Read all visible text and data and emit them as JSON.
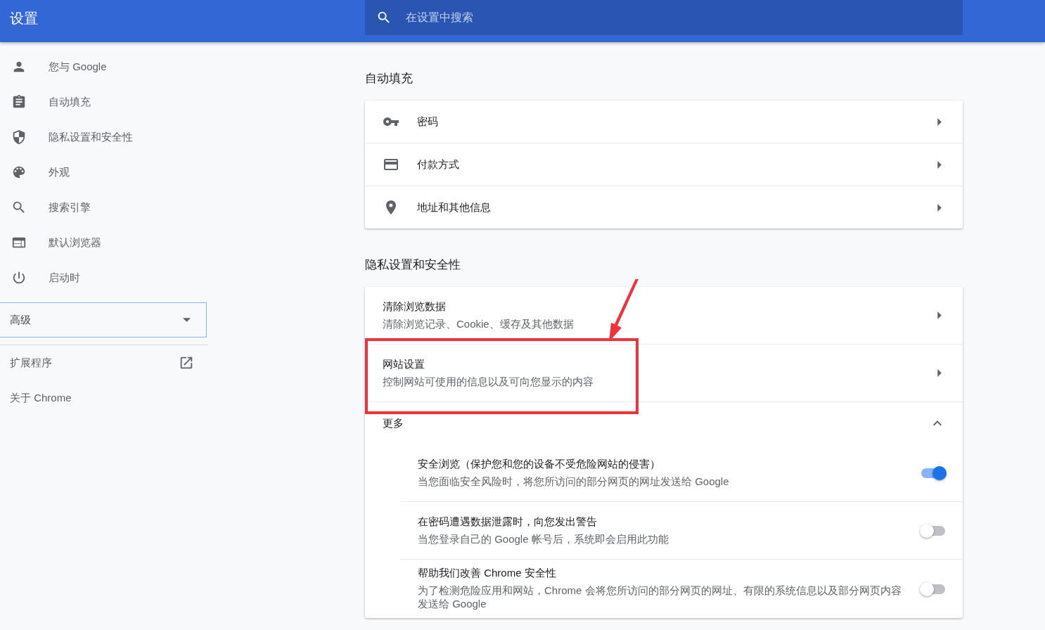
{
  "header": {
    "title": "设置",
    "search": {
      "placeholder": "在设置中搜索"
    }
  },
  "sidebar": {
    "items": [
      {
        "label": "您与 Google"
      },
      {
        "label": "自动填充"
      },
      {
        "label": "隐私设置和安全性"
      },
      {
        "label": "外观"
      },
      {
        "label": "搜索引擎"
      },
      {
        "label": "默认浏览器"
      },
      {
        "label": "启动时"
      }
    ],
    "advanced": {
      "label": "高级",
      "expanded": false
    },
    "links": [
      {
        "label": "扩展程序",
        "external": true
      },
      {
        "label": "关于 Chrome",
        "external": false
      }
    ]
  },
  "sections": [
    {
      "title": "自动填充",
      "rows": [
        {
          "kind": "icon",
          "label": "密码"
        },
        {
          "kind": "icon",
          "label": "付款方式"
        },
        {
          "kind": "icon",
          "label": "地址和其他信息"
        }
      ]
    },
    {
      "title": "隐私设置和安全性",
      "rows": [
        {
          "kind": "described",
          "label": "清除浏览数据",
          "description": "清除浏览记录、Cookie、缓存及其他数据",
          "highlighted": false
        },
        {
          "kind": "described",
          "label": "网站设置",
          "description": "控制网站可使用的信息以及可向您显示的内容",
          "highlighted": true
        }
      ],
      "more": {
        "label": "更多",
        "expanded": true,
        "items": [
          {
            "label": "安全浏览（保护您和您的设备不受危险网站的侵害）",
            "description": "当您面临安全风险时，将您所访问的部分网页的网址发送给 Google",
            "on": true
          },
          {
            "label": "在密码遭遇数据泄露时，向您发出警告",
            "description": "当您登录自己的 Google 帐号后，系统即会启用此功能",
            "on": false
          },
          {
            "label": "帮助我们改善 Chrome 安全性",
            "description": "为了检测危险应用和网站，Chrome 会将您所访问的部分网页的网址、有限的系统信息以及部分网页内容发送给 Google",
            "on": false
          }
        ]
      }
    }
  ]
}
